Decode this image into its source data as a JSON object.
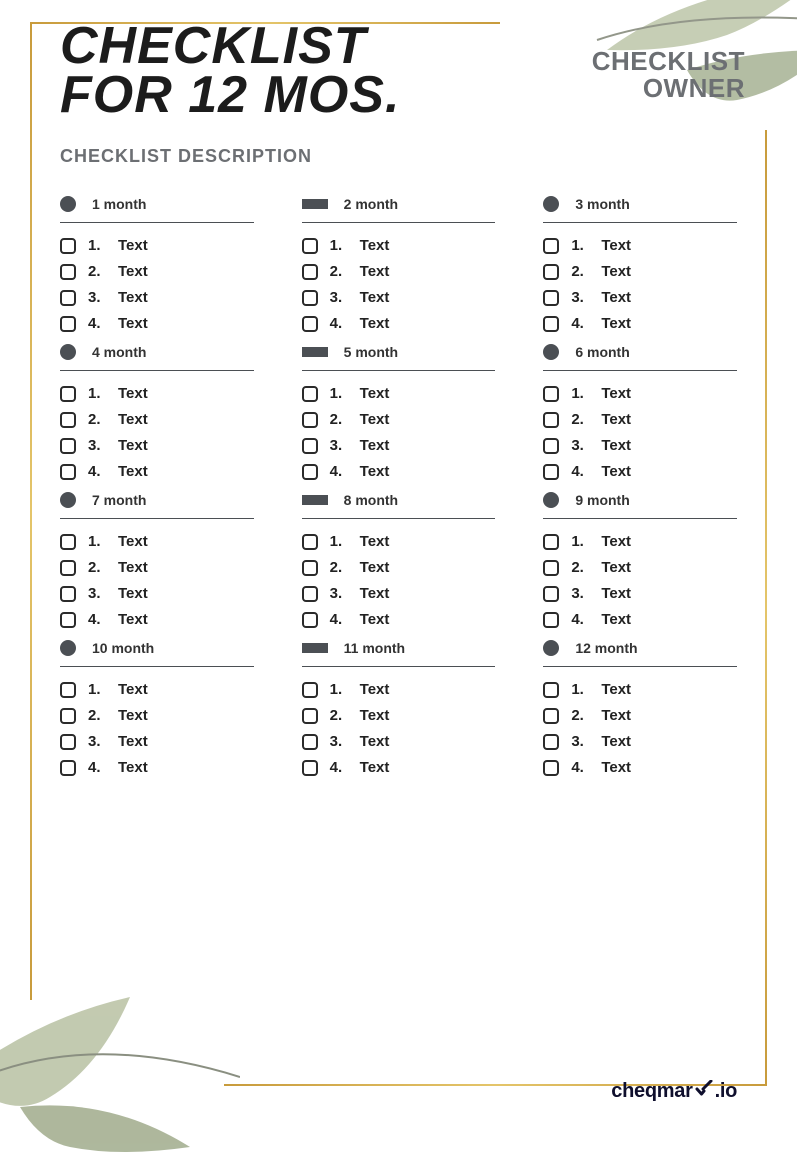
{
  "title_line1": "CHECKLIST",
  "title_line2": "FOR 12 MOS.",
  "owner_line1": "CHECKLIST",
  "owner_line2": "OWNER",
  "description": "CHECKLIST DESCRIPTION",
  "brand_part1": "cheqmar",
  "brand_part2": ".io",
  "months": [
    {
      "bullet": "circle",
      "title": "1 month",
      "items": [
        {
          "num": "1.",
          "text": "Text"
        },
        {
          "num": "2.",
          "text": "Text"
        },
        {
          "num": "3.",
          "text": "Text"
        },
        {
          "num": "4.",
          "text": "Text"
        }
      ]
    },
    {
      "bullet": "bar",
      "title": "2 month",
      "items": [
        {
          "num": "1.",
          "text": "Text"
        },
        {
          "num": "2.",
          "text": "Text"
        },
        {
          "num": "3.",
          "text": "Text"
        },
        {
          "num": "4.",
          "text": "Text"
        }
      ]
    },
    {
      "bullet": "circle",
      "title": "3 month",
      "items": [
        {
          "num": "1.",
          "text": "Text"
        },
        {
          "num": "2.",
          "text": "Text"
        },
        {
          "num": "3.",
          "text": "Text"
        },
        {
          "num": "4.",
          "text": "Text"
        }
      ]
    },
    {
      "bullet": "circle",
      "title": "4 month",
      "items": [
        {
          "num": "1.",
          "text": "Text"
        },
        {
          "num": "2.",
          "text": "Text"
        },
        {
          "num": "3.",
          "text": "Text"
        },
        {
          "num": "4.",
          "text": "Text"
        }
      ]
    },
    {
      "bullet": "bar",
      "title": "5 month",
      "items": [
        {
          "num": "1.",
          "text": "Text"
        },
        {
          "num": "2.",
          "text": "Text"
        },
        {
          "num": "3.",
          "text": "Text"
        },
        {
          "num": "4.",
          "text": "Text"
        }
      ]
    },
    {
      "bullet": "circle",
      "title": "6 month",
      "items": [
        {
          "num": "1.",
          "text": "Text"
        },
        {
          "num": "2.",
          "text": "Text"
        },
        {
          "num": "3.",
          "text": "Text"
        },
        {
          "num": "4.",
          "text": "Text"
        }
      ]
    },
    {
      "bullet": "circle",
      "title": "7 month",
      "items": [
        {
          "num": "1.",
          "text": "Text"
        },
        {
          "num": "2.",
          "text": "Text"
        },
        {
          "num": "3.",
          "text": "Text"
        },
        {
          "num": "4.",
          "text": "Text"
        }
      ]
    },
    {
      "bullet": "bar",
      "title": "8 month",
      "items": [
        {
          "num": "1.",
          "text": "Text"
        },
        {
          "num": "2.",
          "text": "Text"
        },
        {
          "num": "3.",
          "text": "Text"
        },
        {
          "num": "4.",
          "text": "Text"
        }
      ]
    },
    {
      "bullet": "circle",
      "title": "9 month",
      "items": [
        {
          "num": "1.",
          "text": "Text"
        },
        {
          "num": "2.",
          "text": "Text"
        },
        {
          "num": "3.",
          "text": "Text"
        },
        {
          "num": "4.",
          "text": "Text"
        }
      ]
    },
    {
      "bullet": "circle",
      "title": "10 month",
      "items": [
        {
          "num": "1.",
          "text": "Text"
        },
        {
          "num": "2.",
          "text": "Text"
        },
        {
          "num": "3.",
          "text": "Text"
        },
        {
          "num": "4.",
          "text": "Text"
        }
      ]
    },
    {
      "bullet": "bar",
      "title": "11 month",
      "items": [
        {
          "num": "1.",
          "text": "Text"
        },
        {
          "num": "2.",
          "text": "Text"
        },
        {
          "num": "3.",
          "text": "Text"
        },
        {
          "num": "4.",
          "text": "Text"
        }
      ]
    },
    {
      "bullet": "circle",
      "title": "12 month",
      "items": [
        {
          "num": "1.",
          "text": "Text"
        },
        {
          "num": "2.",
          "text": "Text"
        },
        {
          "num": "3.",
          "text": "Text"
        },
        {
          "num": "4.",
          "text": "Text"
        }
      ]
    }
  ]
}
